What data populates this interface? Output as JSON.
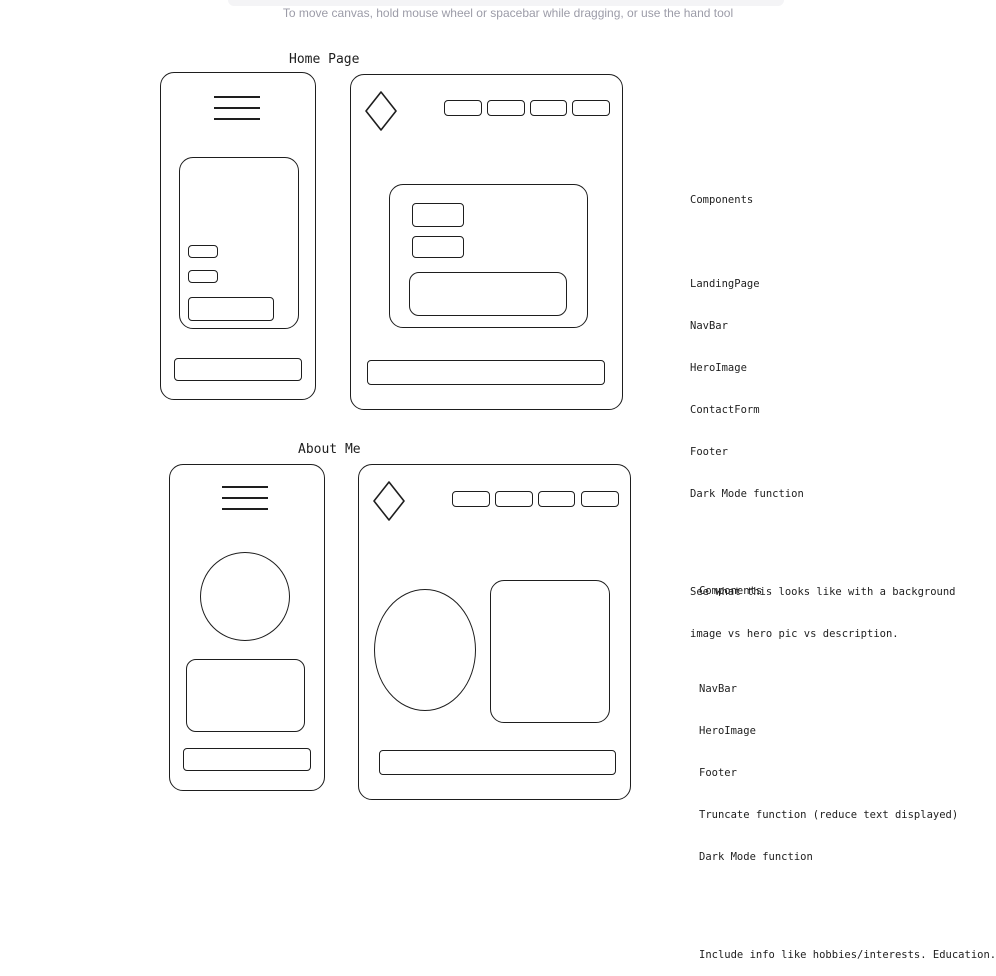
{
  "canvas_hint": "To move canvas, hold mouse wheel or spacebar while dragging, or use the hand tool",
  "home": {
    "title": "Home Page",
    "notes": {
      "heading": "Components",
      "items": [
        "LandingPage",
        "NavBar",
        "HeroImage",
        "ContactForm",
        "Footer",
        "Dark Mode function"
      ],
      "remark_line1": "See what this looks like with a background",
      "remark_line2": "image vs hero pic vs description."
    }
  },
  "about": {
    "title": "About Me",
    "notes": {
      "heading": "Components",
      "items": [
        "NavBar",
        "HeroImage",
        "Footer",
        "Truncate function (reduce text displayed)",
        "Dark Mode function"
      ],
      "remark": "Include info like hobbies/interests. Education."
    }
  },
  "icons": {
    "hamburger": "hamburger-menu-icon",
    "logo": "diamond-logo-icon"
  }
}
